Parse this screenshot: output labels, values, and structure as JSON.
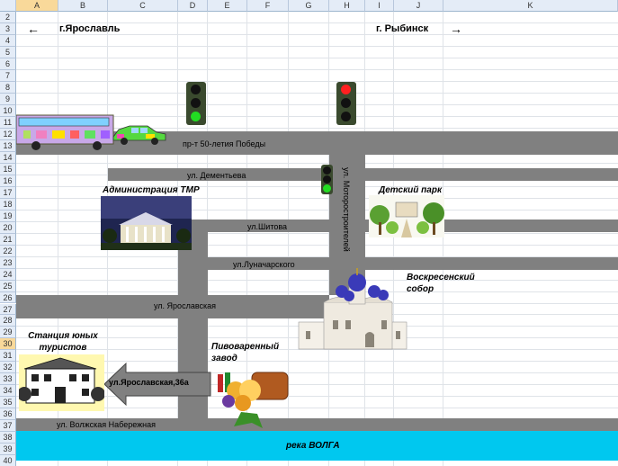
{
  "columns": [
    "A",
    "B",
    "C",
    "D",
    "E",
    "F",
    "G",
    "H",
    "I",
    "J",
    "K"
  ],
  "rows": [
    "2",
    "3",
    "4",
    "5",
    "6",
    "7",
    "8",
    "9",
    "10",
    "11",
    "12",
    "13",
    "14",
    "15",
    "16",
    "17",
    "18",
    "19",
    "20",
    "21",
    "22",
    "23",
    "24",
    "25",
    "26",
    "27",
    "28",
    "29",
    "30",
    "31",
    "32",
    "33",
    "34",
    "35",
    "36",
    "37",
    "38",
    "39",
    "40"
  ],
  "selected_column": "A",
  "selected_row": "30",
  "directions": {
    "left": "г.Ярославль",
    "right": "г. Рыбинск",
    "left_arrow": "←",
    "right_arrow": "→"
  },
  "streets": {
    "pobedy": "пр-т   50-летия  Победы",
    "dementyeva": "ул. Дементьева",
    "motorostroiteley": "ул. Моторостроителей",
    "shitova": "ул.Шитова",
    "lunacharskogo": "ул.Луначарского",
    "yaroslavskaya": "ул. Ярославская",
    "naberezhnaya": "ул. Волжская Набережная"
  },
  "places": {
    "administration": "Администрация ТМР",
    "park": "Детский парк",
    "cathedral": "Воскресенский собор",
    "brewery": "Пивоваренный завод",
    "station": "Станция юных туристов",
    "address_arrow": "ул.Ярославская,36а",
    "river": "река ВОЛГА"
  },
  "colors": {
    "road": "#808080",
    "river": "#00c8ef",
    "header": "#e4ecf7",
    "header_selected": "#f9d99a",
    "light_red": "#ff2020",
    "light_green": "#22dd22"
  },
  "traffic_lights": [
    {
      "id": "left",
      "state": "green"
    },
    {
      "id": "right",
      "state": "red"
    },
    {
      "id": "small",
      "state": "green"
    }
  ]
}
